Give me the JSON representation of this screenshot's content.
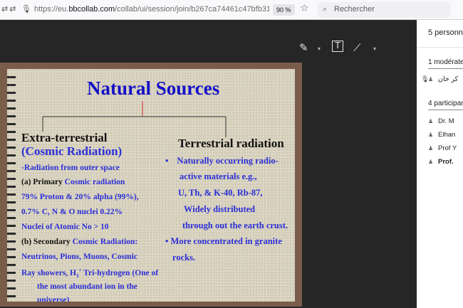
{
  "browser": {
    "left_icons": "⇄⇄ 🎙",
    "url_prefix": "https://eu.",
    "url_domain": "bbcollab.com",
    "url_path": "/collab/ui/session/join/b267ca74461c47bfb31",
    "zoom": "90 %",
    "star_icon": "☆",
    "search_icon": "⌕",
    "search_placeholder": "Rechercher"
  },
  "toolbar": {
    "pencil_icon": "✎",
    "text_icon": "T",
    "line_icon": "⟋",
    "caret": "▾"
  },
  "slide": {
    "title": "Natural Sources",
    "left_heading_1": "Extra-terrestrial",
    "left_heading_2": "(Cosmic Radiation)",
    "lines": [
      "-Radiation from outer space",
      "(a)   Primary",
      " Cosmic radiation",
      "79% Proton & 20% alpha (99%),",
      "  0.7% C, N & O nuclei 0.22%",
      "Nuclei of Atomic No > 10",
      "(b) Secondary",
      " Cosmic Radiation:",
      "Neutrinos, Pions, Muons, Cosmic",
      "Ray showers, H",
      "3",
      "+",
      " Tri-hydrogen (One of",
      "the most  abundant ion in the",
      "universe)"
    ],
    "right_heading": "Terrestrial radiation",
    "right_lines": [
      "•",
      "Naturally occurring radio-",
      "active materials e.g.,",
      "U, Th, & K-40, Rb-87,",
      "Widely distributed",
      "through out the earth crust.",
      "• More concentrated in granite",
      "rocks."
    ]
  },
  "panel": {
    "header": "5 personnes",
    "moderators_label": "1 modérateur",
    "moderator_name": "کر خان",
    "participants_label": "4 participants",
    "participants": [
      "Dr. M",
      "Elhan",
      "Prof Y",
      "Prof."
    ],
    "user_icon": "♟",
    "mic_icon": "🎙"
  }
}
